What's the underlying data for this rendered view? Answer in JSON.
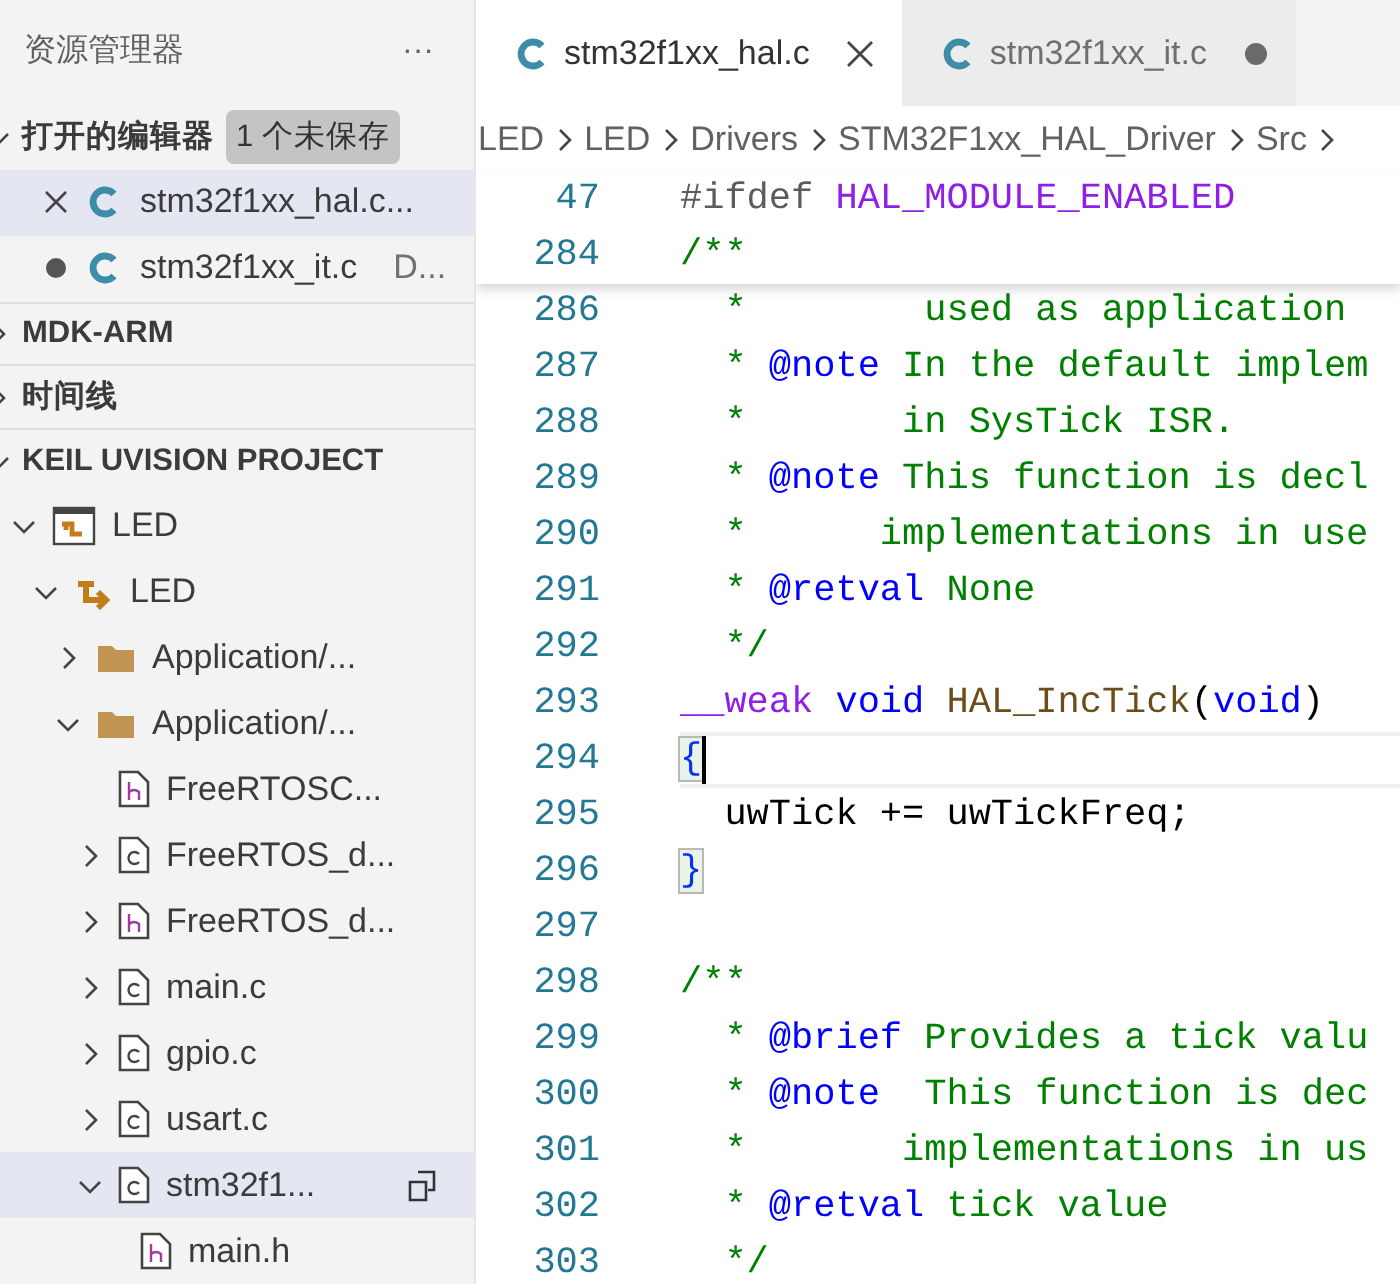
{
  "sidebar": {
    "title": "资源管理器",
    "more": "···",
    "sections": [
      {
        "title": "打开的编辑器",
        "expanded": true,
        "badge": "1 个未保存",
        "kind": "editors"
      },
      {
        "title": "MDK-ARM",
        "expanded": false
      },
      {
        "title": "时间线",
        "expanded": false
      },
      {
        "title": "KEIL UVISION PROJECT",
        "expanded": true,
        "kind": "tree"
      }
    ],
    "open_editors": [
      {
        "name": "stm32f1xx_hal.c...",
        "dirty": false,
        "selected": true
      },
      {
        "name": "stm32f1xx_it.c",
        "description": "D...",
        "dirty": true,
        "selected": false
      }
    ],
    "tree": [
      {
        "label": "LED",
        "kind": "project",
        "expanded": true,
        "selected": false,
        "children": [
          {
            "label": "LED",
            "kind": "target",
            "expanded": true,
            "selected": false,
            "children": [
              {
                "label": "Application/...",
                "kind": "folder",
                "expanded": false,
                "selected": false
              },
              {
                "label": "Application/...",
                "kind": "folder",
                "expanded": true,
                "selected": false,
                "children": [
                  {
                    "label": "FreeRTOSC...",
                    "kind": "h"
                  },
                  {
                    "label": "FreeRTOS_d...",
                    "kind": "c",
                    "expanded": false,
                    "selected": false
                  },
                  {
                    "label": "FreeRTOS_d...",
                    "kind": "h",
                    "expanded": false,
                    "selected": false
                  },
                  {
                    "label": "main.c",
                    "kind": "c",
                    "expanded": false,
                    "selected": false
                  },
                  {
                    "label": "gpio.c",
                    "kind": "c",
                    "expanded": false,
                    "selected": false
                  },
                  {
                    "label": "usart.c",
                    "kind": "c",
                    "expanded": false,
                    "selected": false
                  },
                  {
                    "label": "stm32f1...",
                    "kind": "c",
                    "expanded": true,
                    "selected": true,
                    "children": [
                      {
                        "label": "main.h",
                        "kind": "h"
                      }
                    ]
                  }
                ]
              }
            ]
          }
        ]
      }
    ]
  },
  "tabs": [
    {
      "label": "stm32f1xx_hal.c",
      "selected": true,
      "dirty": false
    },
    {
      "label": "stm32f1xx_it.c",
      "selected": false,
      "dirty": true
    }
  ],
  "breadcrumb": [
    "LED",
    "LED",
    "Drivers",
    "STM32F1xx_HAL_Driver",
    "Src"
  ],
  "sticky_lines": [
    {
      "number": "47",
      "tokens": [
        {
          "text": "#ifdef ",
          "kind": "directive"
        },
        {
          "text": "HAL_MODULE_ENABLED",
          "kind": "macro"
        }
      ]
    },
    {
      "number": "284",
      "tokens": [
        {
          "text": "/**",
          "kind": "comment"
        }
      ]
    }
  ],
  "lines": [
    {
      "number": "286",
      "tokens": [
        {
          "text": "  *        used as application",
          "kind": "comment"
        }
      ]
    },
    {
      "number": "287",
      "tokens": [
        {
          "text": "  * ",
          "kind": "comment"
        },
        {
          "text": "@note",
          "kind": "doctag"
        },
        {
          "text": " In the default implem",
          "kind": "comment"
        }
      ]
    },
    {
      "number": "288",
      "tokens": [
        {
          "text": "  *       in SysTick ISR.",
          "kind": "comment"
        }
      ]
    },
    {
      "number": "289",
      "tokens": [
        {
          "text": "  * ",
          "kind": "comment"
        },
        {
          "text": "@note",
          "kind": "doctag"
        },
        {
          "text": " This function is decl",
          "kind": "comment"
        }
      ]
    },
    {
      "number": "290",
      "tokens": [
        {
          "text": "  *      implementations in use",
          "kind": "comment"
        }
      ]
    },
    {
      "number": "291",
      "tokens": [
        {
          "text": "  * ",
          "kind": "comment"
        },
        {
          "text": "@retval",
          "kind": "doctag"
        },
        {
          "text": " None",
          "kind": "comment"
        }
      ]
    },
    {
      "number": "292",
      "tokens": [
        {
          "text": "  */",
          "kind": "comment"
        }
      ]
    },
    {
      "number": "293",
      "tokens": [
        {
          "text": "__weak",
          "kind": "macro"
        },
        {
          "text": " void",
          "kind": "keyword"
        },
        {
          "text": " HAL_IncTick",
          "kind": "func"
        },
        {
          "text": "(",
          "kind": "plain"
        },
        {
          "text": "void",
          "kind": "keyword"
        },
        {
          "text": ")",
          "kind": "plain"
        }
      ]
    },
    {
      "number": "294",
      "current": true,
      "tokens": [
        {
          "text": "{",
          "kind": "bracket"
        }
      ]
    },
    {
      "number": "295",
      "tokens": [
        {
          "text": "  uwTick += uwTickFreq;",
          "kind": "plain"
        }
      ]
    },
    {
      "number": "296",
      "tokens": [
        {
          "text": "}",
          "kind": "bracket"
        }
      ]
    },
    {
      "number": "297"
    },
    {
      "number": "298",
      "tokens": [
        {
          "text": "/**",
          "kind": "comment"
        }
      ]
    },
    {
      "number": "299",
      "tokens": [
        {
          "text": "  * ",
          "kind": "comment"
        },
        {
          "text": "@brief",
          "kind": "doctag"
        },
        {
          "text": " Provides a tick valu",
          "kind": "comment"
        }
      ]
    },
    {
      "number": "300",
      "tokens": [
        {
          "text": "  * ",
          "kind": "comment"
        },
        {
          "text": "@note",
          "kind": "doctag"
        },
        {
          "text": "  This function is dec",
          "kind": "comment"
        }
      ]
    },
    {
      "number": "301",
      "tokens": [
        {
          "text": "  *       implementations in us",
          "kind": "comment"
        }
      ]
    },
    {
      "number": "302",
      "tokens": [
        {
          "text": "  * ",
          "kind": "comment"
        },
        {
          "text": "@retval",
          "kind": "doctag"
        },
        {
          "text": " tick value",
          "kind": "comment"
        }
      ]
    },
    {
      "number": "303",
      "tokens": [
        {
          "text": "  */",
          "kind": "comment"
        }
      ]
    }
  ]
}
